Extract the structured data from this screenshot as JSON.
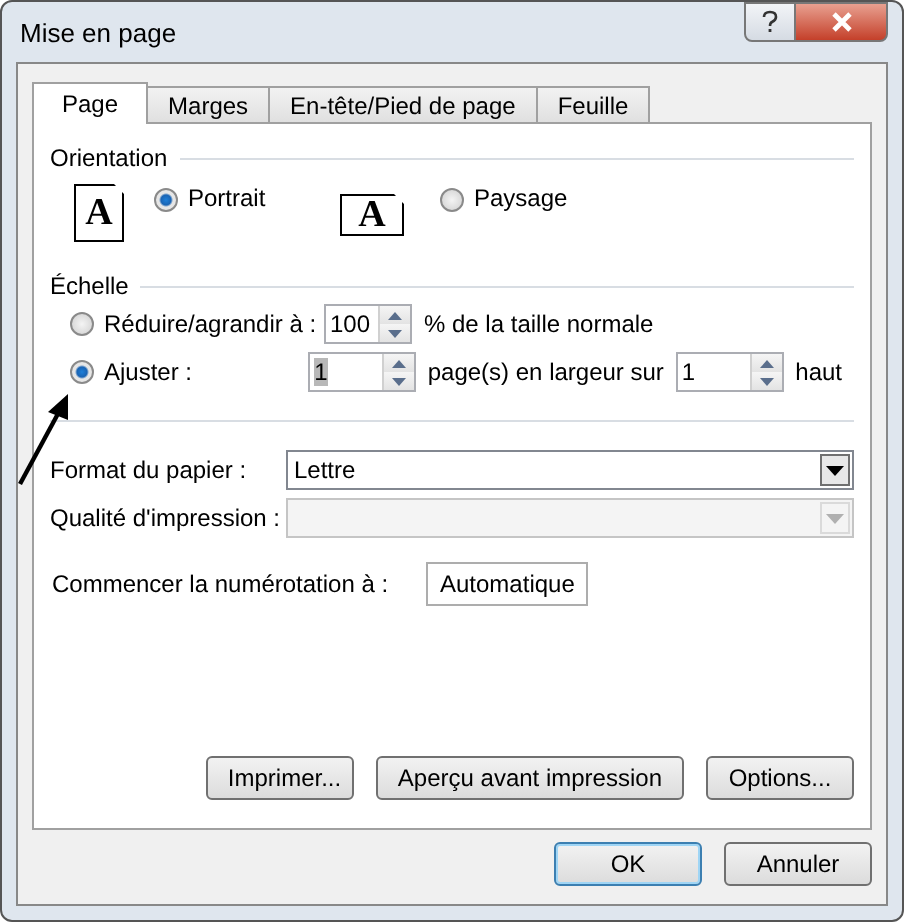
{
  "window": {
    "title": "Mise en page"
  },
  "tabs": [
    {
      "label": "Page",
      "selected": true
    },
    {
      "label": "Marges",
      "selected": false
    },
    {
      "label": "En-tête/Pied de page",
      "selected": false
    },
    {
      "label": "Feuille",
      "selected": false
    }
  ],
  "orientation": {
    "heading": "Orientation",
    "options": [
      {
        "kind": "portrait",
        "icon_text": "A",
        "label": "Portrait",
        "selected": true
      },
      {
        "kind": "landscape",
        "icon_text": "A",
        "label": "Paysage",
        "selected": false
      }
    ]
  },
  "scale": {
    "heading": "Échelle",
    "options": [
      {
        "kind": "percent",
        "label": "Réduire/agrandir à :",
        "selected": false,
        "value": "100",
        "suffix": "% de la taille normale"
      },
      {
        "kind": "fit",
        "label": "Ajuster :",
        "selected": true,
        "width_value": "1",
        "width_value_highlighted": true,
        "width_suffix": "page(s) en largeur sur",
        "height_value": "1",
        "height_suffix": "haut"
      }
    ]
  },
  "paper_size": {
    "label": "Format du papier :",
    "value": "Lettre",
    "disabled": false
  },
  "print_quality": {
    "label": "Qualité d'impression :",
    "disabled": true
  },
  "first_page_number": {
    "label": "Commencer la numérotation à :",
    "value": "Automatique"
  },
  "panel_buttons": [
    {
      "label": "Imprimer..."
    },
    {
      "label": "Aperçu avant impression"
    },
    {
      "label": "Options..."
    }
  ],
  "buttons": [
    {
      "label": "OK",
      "default": true
    },
    {
      "label": "Annuler",
      "default": false
    }
  ]
}
